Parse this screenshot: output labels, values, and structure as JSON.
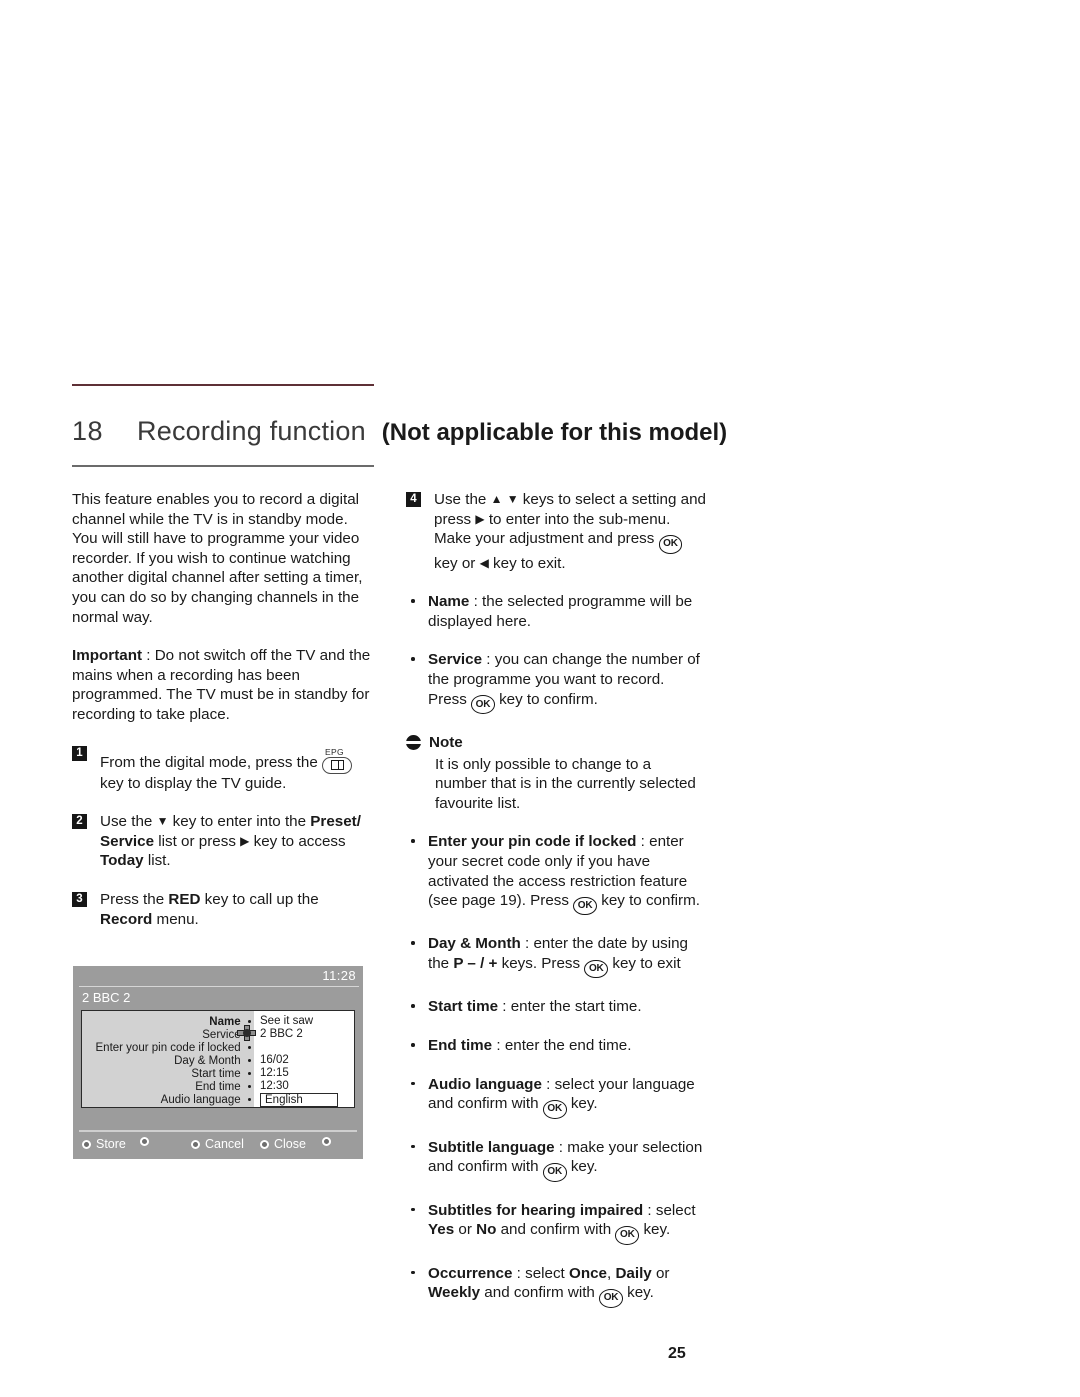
{
  "header": {
    "chapter_number": "18",
    "chapter_title": "Recording function",
    "chapter_note": "(Not applicable for this model)"
  },
  "left_column": {
    "intro": "This feature enables you to record a digital channel while the TV is in standby mode. You will still have to programme your video recorder. If you wish to continue watching another digital channel after setting a timer, you can do so by changing channels in the normal way.",
    "important_label": "Important",
    "important_body": " : Do not switch off the TV and the mains when a recording has been programmed. The TV must be in standby for recording to take place.",
    "steps": [
      {
        "num": "1",
        "part1": "From the digital mode, press the ",
        "icon": "epg-key-icon",
        "icon_label": "EPG",
        "part2": "key to display the TV guide."
      },
      {
        "num": "2",
        "t1": "Use the ",
        "arrow_down": "▼",
        "t2": " key to enter into the ",
        "b1": "Preset/ Service",
        "t3": " list or press ",
        "arrow_right": "▶",
        "t4": " key to access ",
        "b2": "Today",
        "t5": " list."
      },
      {
        "num": "3",
        "t1": "Press the ",
        "b1": "RED",
        "t2": " key to call up the ",
        "b2": "Record",
        "t3": " menu."
      }
    ]
  },
  "tv_screen": {
    "clock": "11:28",
    "channel": "2 BBC 2",
    "rows": [
      {
        "label": "Name",
        "value": "See it saw",
        "bold": true,
        "boxed": false
      },
      {
        "label": "Service",
        "value": "2 BBC 2",
        "bold": false,
        "boxed": false
      },
      {
        "label": "Enter your pin code if locked",
        "value": "",
        "bold": false,
        "boxed": false
      },
      {
        "label": "Day & Month",
        "value": "16/02",
        "bold": false,
        "boxed": false
      },
      {
        "label": "Start time",
        "value": "12:15",
        "bold": false,
        "boxed": false
      },
      {
        "label": "End time",
        "value": "12:30",
        "bold": false,
        "boxed": false
      },
      {
        "label": "Audio language",
        "value": "English",
        "bold": false,
        "boxed": true
      }
    ],
    "actions": [
      {
        "label": "Store"
      },
      {
        "label": ""
      },
      {
        "label": "Cancel"
      },
      {
        "label": "Close"
      },
      {
        "label": ""
      }
    ]
  },
  "right_column": {
    "step4": {
      "num": "4",
      "t1": "Use the ",
      "arrow_up": "▲",
      "arrow_down": "▼",
      "t2": " keys to select a setting and press ",
      "arrow_right": "▶",
      "t3": " to enter into the sub-menu. Make your adjustment and press ",
      "ok": "OK",
      "t4": " key or ",
      "arrow_left": "◀",
      "t5": " key to exit."
    },
    "bullets": [
      {
        "term": "Name",
        "sep": " : ",
        "body": "the selected programme will be displayed here."
      },
      {
        "term": "Service",
        "sep": " : ",
        "body": "you can change the number of the programme you want to record. Press ",
        "ok": "OK",
        "body2": " key to confirm."
      }
    ],
    "note": {
      "icon": "note-icon",
      "title": "Note",
      "body": "It is only possible to change to a number that is in the currently selected favourite list."
    },
    "bullets2": [
      {
        "term": "Enter your pin code if locked",
        "sep": " : ",
        "body": "enter your secret code only if you have activated the access restriction feature (see page 19). Press ",
        "ok": "OK",
        "body2": " key to confirm."
      },
      {
        "term": "Day & Month",
        "sep": " : ",
        "body": "enter the date by using the ",
        "keys": "P – / +",
        "body2": " keys. Press ",
        "ok": "OK",
        "body3": " key to exit"
      },
      {
        "term": "Start time",
        "sep": " : ",
        "body": "enter the start time."
      },
      {
        "term": "End time",
        "sep": " : ",
        "body": "enter the end time."
      },
      {
        "term": "Audio language",
        "sep": " : ",
        "body": "select your language and confirm with ",
        "ok": "OK",
        "body2": " key."
      },
      {
        "term": "Subtitle language",
        "sep": " : ",
        "body": "make your selection and confirm with ",
        "ok": "OK",
        "body2": " key."
      },
      {
        "term": "Subtitles for hearing impaired",
        "sep": " : ",
        "body": "select ",
        "opt1": "Yes",
        "mid1": " or ",
        "opt2": "No",
        "mid2": " and confirm with ",
        "ok": "OK",
        "body2": " key."
      },
      {
        "term": "Occurrence",
        "sep": " : ",
        "body": "select ",
        "opt1": "Once",
        "mid1": ", ",
        "opt2": "Daily",
        "mid2": " or ",
        "opt3": "Weekly",
        "mid3": " and confirm with ",
        "ok": "OK",
        "body2": " key."
      }
    ]
  },
  "footer": {
    "page_number": "25"
  },
  "colors": {
    "rule_top": "#5e3036",
    "rule_bottom": "#6b6b6b",
    "tv_background": "#9c9c9c",
    "tv_label_panel": "#d2d2d2",
    "step_marker": "#161616"
  }
}
